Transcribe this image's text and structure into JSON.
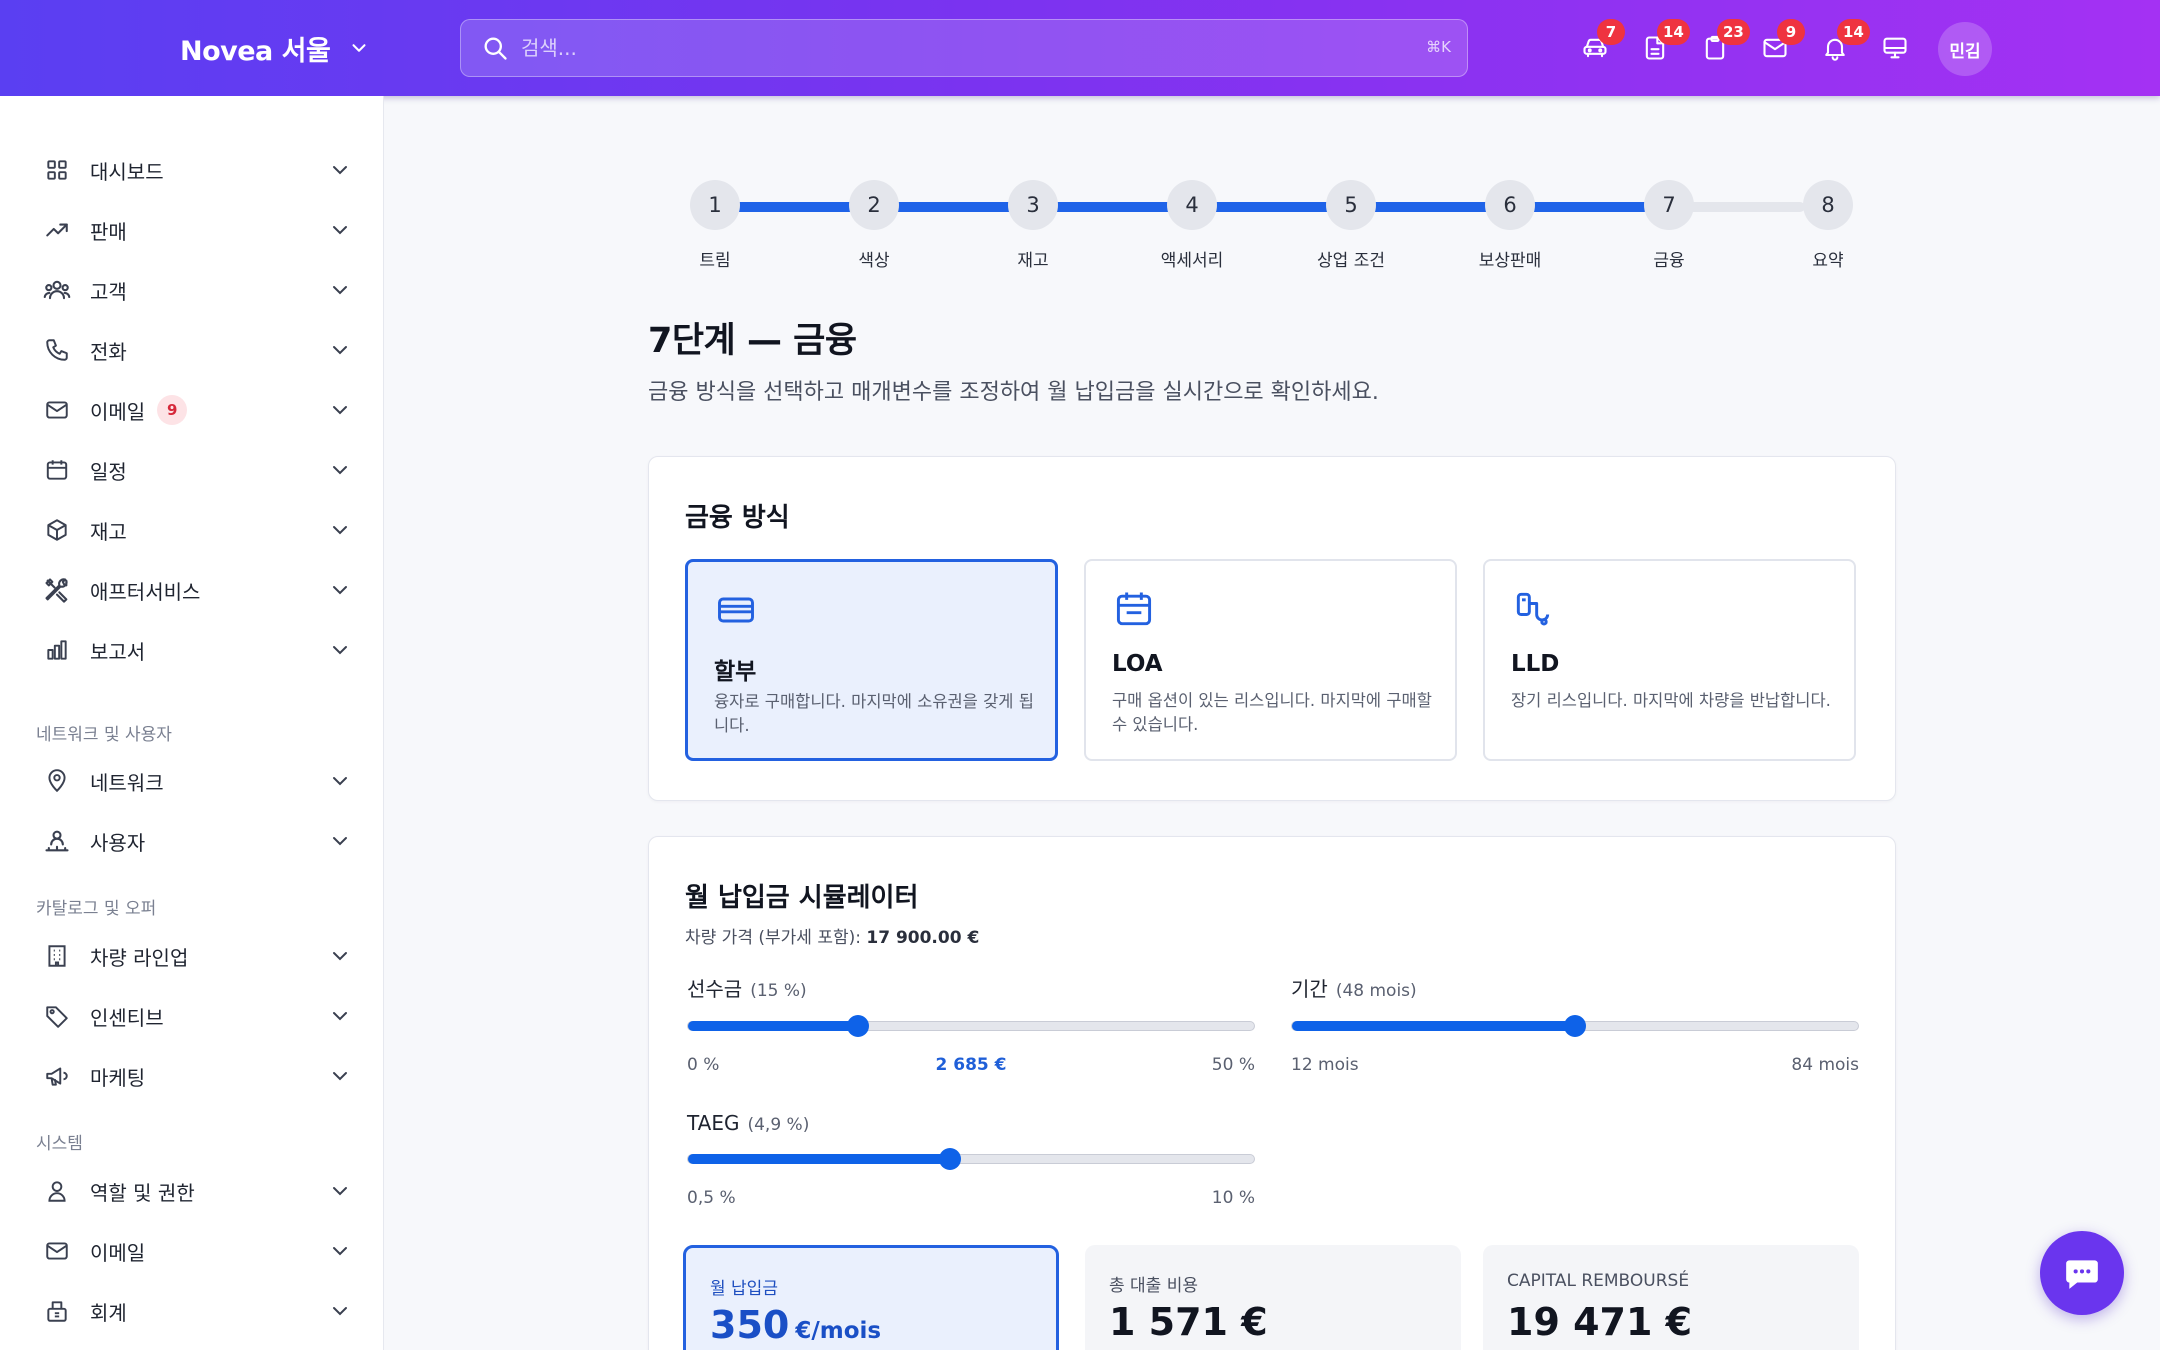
{
  "topbar": {
    "brand": "Novea 서울",
    "search_placeholder": "검색...",
    "search_shortcut": "⌘K",
    "icons": [
      {
        "name": "car-icon",
        "badge": "7"
      },
      {
        "name": "document-icon",
        "badge": "14"
      },
      {
        "name": "clipboard-icon",
        "badge": "23"
      },
      {
        "name": "mail-icon",
        "badge": "9"
      },
      {
        "name": "bell-icon",
        "badge": "14"
      },
      {
        "name": "monitor-icon",
        "badge": ""
      }
    ],
    "avatar": "민김"
  },
  "sidebar": {
    "items": [
      {
        "label": "대시보드",
        "icon": "grid-icon"
      },
      {
        "label": "판매",
        "icon": "trend-up-icon"
      },
      {
        "label": "고객",
        "icon": "users-icon"
      },
      {
        "label": "전화",
        "icon": "phone-icon"
      },
      {
        "label": "이메일",
        "icon": "mail-icon",
        "badge": "9"
      },
      {
        "label": "일정",
        "icon": "calendar-icon"
      },
      {
        "label": "재고",
        "icon": "box-icon"
      },
      {
        "label": "애프터서비스",
        "icon": "tools-icon"
      },
      {
        "label": "보고서",
        "icon": "bar-chart-icon"
      },
      {
        "label": "네트워크",
        "icon": "map-pin-icon"
      },
      {
        "label": "사용자",
        "icon": "user-network-icon"
      },
      {
        "label": "차량 라인업",
        "icon": "building-icon"
      },
      {
        "label": "인센티브",
        "icon": "tag-icon"
      },
      {
        "label": "마케팅",
        "icon": "megaphone-icon"
      },
      {
        "label": "역할 및 권한",
        "icon": "user-icon"
      },
      {
        "label": "이메일",
        "icon": "mail-icon"
      },
      {
        "label": "회계",
        "icon": "cash-register-icon"
      }
    ],
    "sections": [
      "네트워크 및 사용자",
      "카탈로그 및 오퍼",
      "시스템"
    ]
  },
  "stepper": {
    "current": 7,
    "steps": [
      "트림",
      "색상",
      "재고",
      "액세서리",
      "상업 조건",
      "보상판매",
      "금융",
      "요약"
    ],
    "progress_color": "#1f63e8"
  },
  "heading": {
    "title": "7단계 — 금융",
    "subtitle": "금융 방식을 선택하고 매개변수를 조정하여 월 납입금을 실시간으로 확인하세요."
  },
  "financing": {
    "title": "금융 방식",
    "options": [
      {
        "title": "할부",
        "desc": "융자로 구매합니다. 마지막에 소유권을 갖게 됩니다.",
        "icon": "card-icon",
        "selected": true
      },
      {
        "title": "LOA",
        "desc": "구매 옵션이 있는 리스입니다. 마지막에 구매할 수 있습니다.",
        "icon": "calendar-icon",
        "selected": false
      },
      {
        "title": "LLD",
        "desc": "장기 리스입니다. 마지막에 차량을 반납합니다.",
        "icon": "key-icon",
        "selected": false
      }
    ]
  },
  "simulator": {
    "title": "월 납입금 시뮬레이터",
    "price_label": "차량 가격 (부가세 포함):",
    "price_value": "17 900.00 €",
    "sliders": [
      {
        "label": "선수금",
        "hint": "(15 %)",
        "min": "0 %",
        "max": "50 %",
        "mid": "2 685 €",
        "fraction": 0.3
      },
      {
        "label": "기간",
        "hint": "(48 mois)",
        "min": "12 mois",
        "max": "84 mois",
        "mid": "",
        "fraction": 0.5
      },
      {
        "label": "TAEG",
        "hint": "(4,9 %)",
        "min": "0,5 %",
        "max": "10 %",
        "mid": "",
        "fraction": 0.463
      }
    ],
    "results": [
      {
        "label": "월 납입금",
        "value": "350",
        "unit": "€/mois",
        "selected": true
      },
      {
        "label": "총 대출 비용",
        "value": "1 571 €",
        "unit": "",
        "selected": false
      },
      {
        "label": "CAPITAL REMBOURSÉ",
        "value": "19 471 €",
        "unit": "",
        "selected": false
      }
    ]
  },
  "chat": {
    "icon": "chat-icon"
  },
  "colors": {
    "accent": "#2361e0",
    "topbar_start": "#5a3ff2",
    "topbar_end": "#a431f3",
    "badge": "#ef3340"
  }
}
